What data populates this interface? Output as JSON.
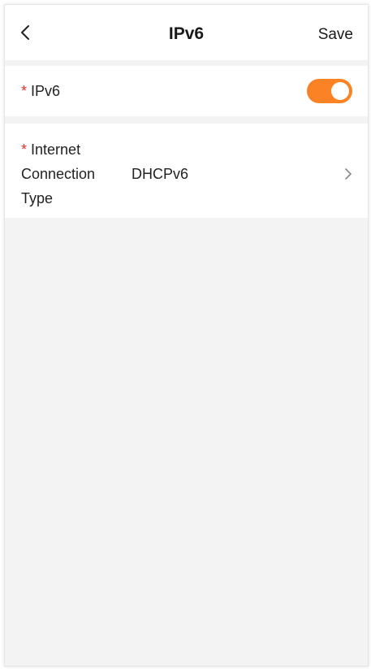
{
  "header": {
    "title": "IPv6",
    "save_label": "Save"
  },
  "ipv6_row": {
    "required_mark": "*",
    "label": "IPv6",
    "toggle_on": true,
    "toggle_color": "#fb8326"
  },
  "connection_row": {
    "required_mark": "*",
    "label_line1": "Internet",
    "label_line2": "Connection",
    "label_line3": "Type",
    "value": "DHCPv6"
  },
  "colors": {
    "accent": "#fb8326",
    "required": "#e0322d",
    "background": "#f3f3f3"
  }
}
